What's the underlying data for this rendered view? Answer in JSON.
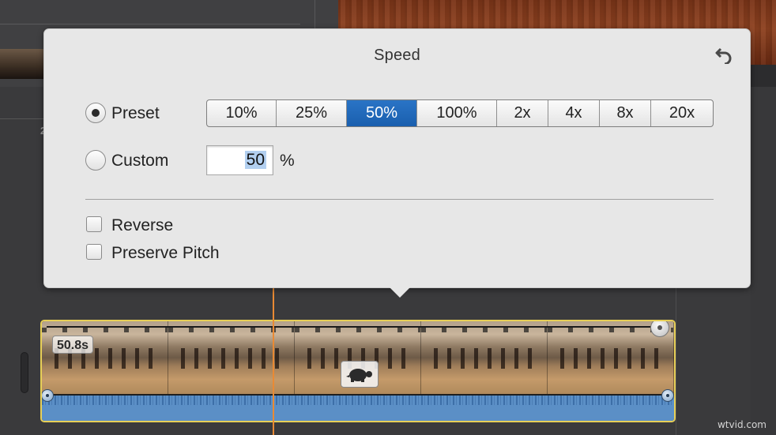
{
  "popover": {
    "title": "Speed",
    "mode_options": {
      "preset_label": "Preset",
      "custom_label": "Custom",
      "selected": "Preset"
    },
    "presets": [
      "10%",
      "25%",
      "50%",
      "100%",
      "2x",
      "4x",
      "8x",
      "20x"
    ],
    "selected_preset": "50%",
    "custom_value": "50",
    "custom_unit": "%",
    "options": {
      "reverse_label": "Reverse",
      "reverse_checked": false,
      "preserve_pitch_label": "Preserve Pitch",
      "preserve_pitch_checked": false
    }
  },
  "timeline": {
    "ruler_tick": "2",
    "clip_duration": "50.8s",
    "speed_icon": "turtle-icon"
  },
  "watermark": "wtvid.com",
  "colors": {
    "selected_segment": "#1a62b3",
    "clip_border": "#e7cf57",
    "audio": "#5b8fc6",
    "playhead": "#e98a34"
  }
}
